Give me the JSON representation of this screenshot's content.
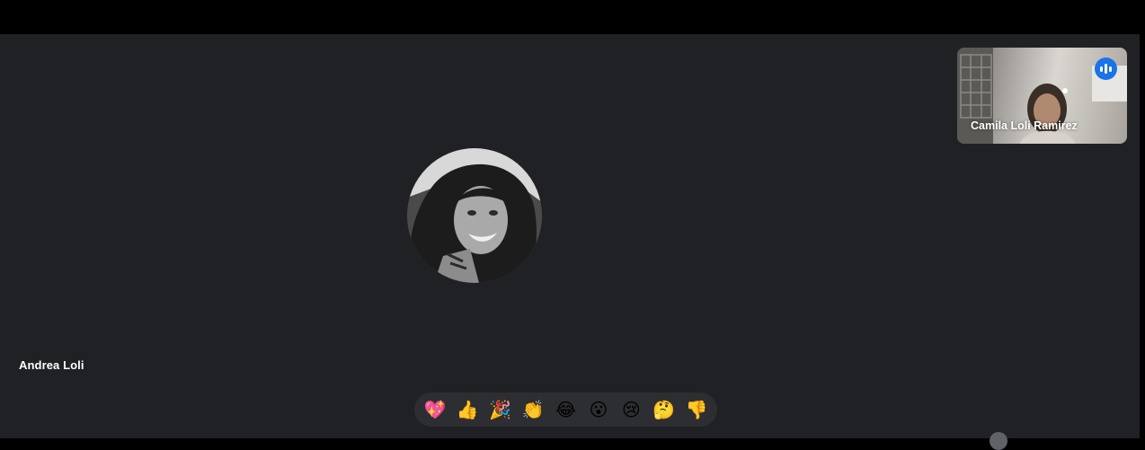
{
  "stage": {
    "participant_name": "Andrea Loli",
    "avatar_icon": "participant-photo-avatar"
  },
  "self_view": {
    "name": "Camila Loli Ramirez",
    "speaking_icon": "audio-level-icon",
    "indicator_color": "#1a73e8"
  },
  "reactions": [
    {
      "icon": "sparkling-heart-icon",
      "emoji": "💖"
    },
    {
      "icon": "thumbs-up-icon",
      "emoji": "👍"
    },
    {
      "icon": "party-popper-icon",
      "emoji": "🎉"
    },
    {
      "icon": "clapping-hands-icon",
      "emoji": "👏"
    },
    {
      "icon": "tears-of-joy-icon",
      "emoji": "😂"
    },
    {
      "icon": "surprised-face-icon",
      "emoji": "😮"
    },
    {
      "icon": "sad-face-icon",
      "emoji": "😢"
    },
    {
      "icon": "thinking-face-icon",
      "emoji": "🤔"
    },
    {
      "icon": "thumbs-down-icon",
      "emoji": "👎"
    }
  ],
  "colors": {
    "stage_background": "#202124",
    "reaction_bar": "#2d2e31",
    "top_bar": "#000000"
  }
}
